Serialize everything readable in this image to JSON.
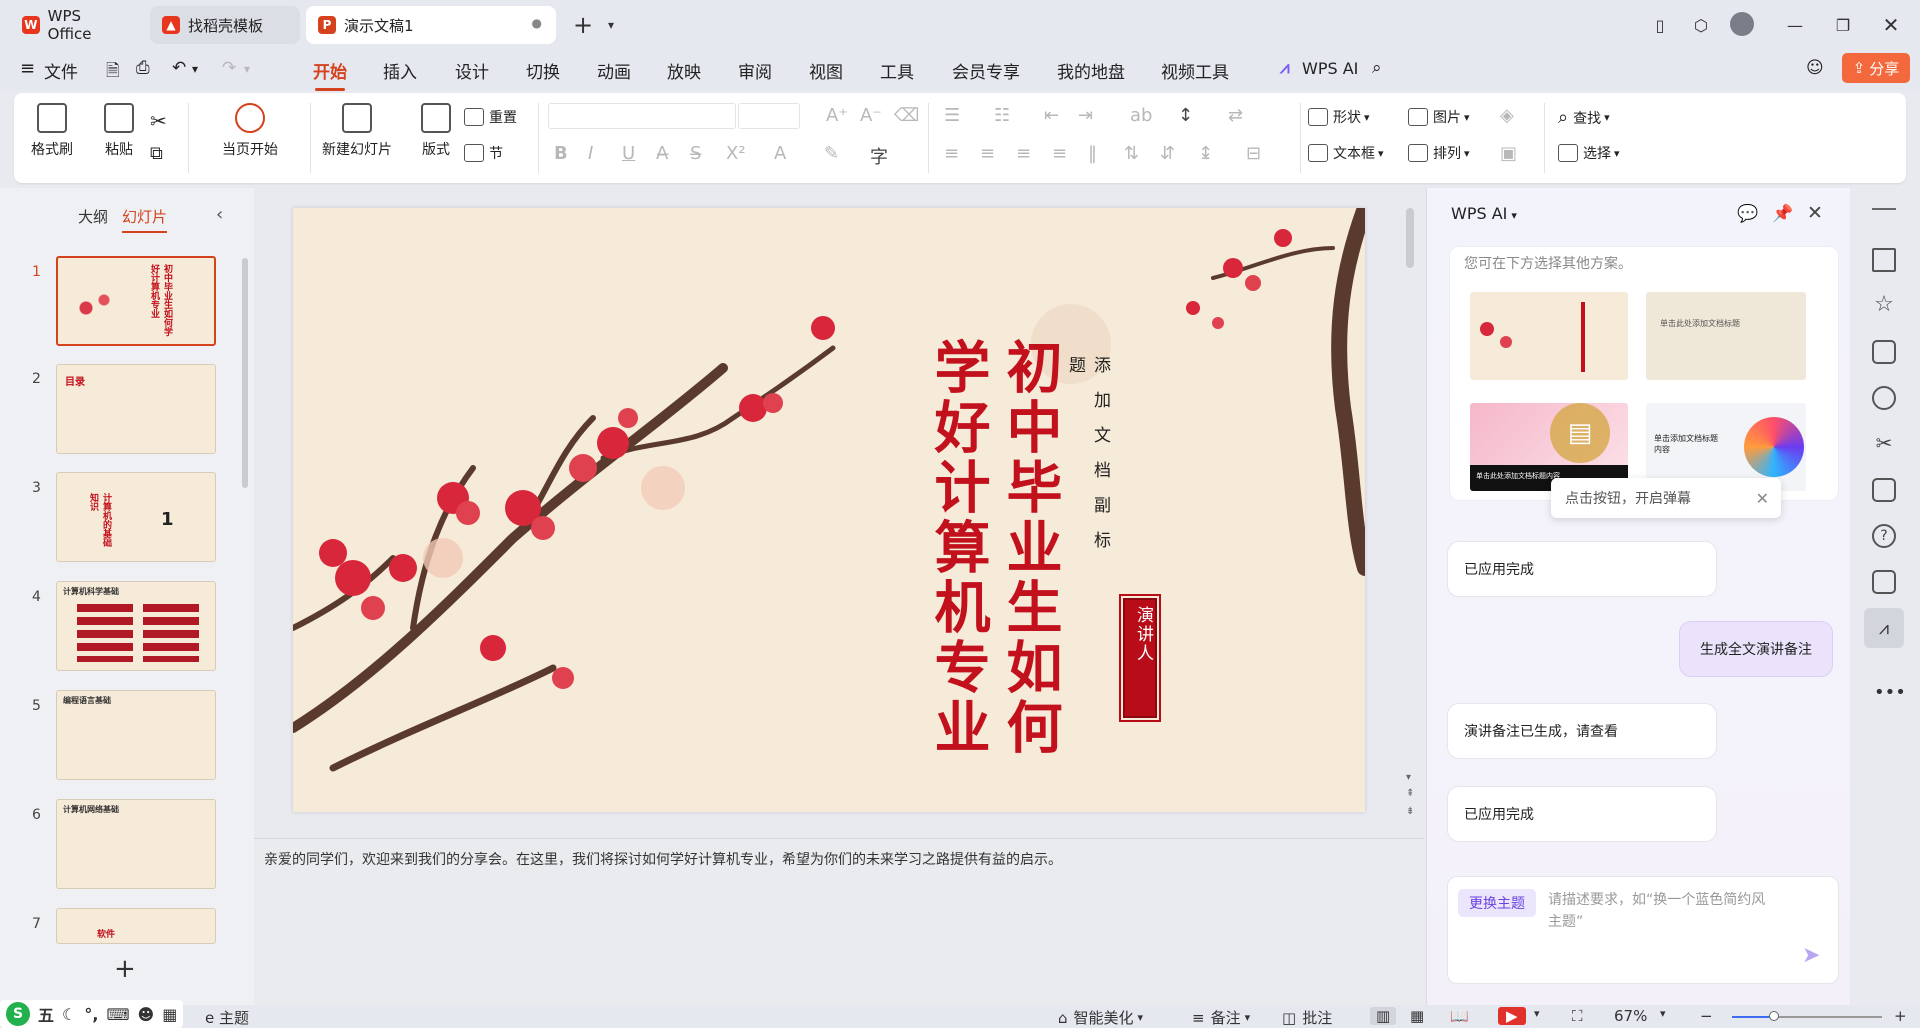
{
  "tabs": [
    {
      "label": "WPS Office",
      "icon": "wps-logo-icon"
    },
    {
      "label": "找稻壳模板",
      "icon": "docer-icon"
    },
    {
      "label": "演示文稿1",
      "icon": "presentation-icon"
    }
  ],
  "window": {
    "new_tab": "+"
  },
  "menu": {
    "file": "文件",
    "items": [
      "开始",
      "插入",
      "设计",
      "切换",
      "动画",
      "放映",
      "审阅",
      "视图",
      "工具",
      "会员专享",
      "我的地盘",
      "视频工具"
    ],
    "active": "开始",
    "wps_ai": "WPS AI",
    "share": "分享"
  },
  "ribbon": {
    "format_painter": "格式刷",
    "paste": "粘贴",
    "play_from_current": "当页开始",
    "new_slide": "新建幻灯片",
    "layout": "版式",
    "reset": "重置",
    "section": "节",
    "shape": "形状",
    "picture": "图片",
    "find": "查找",
    "textbox": "文本框",
    "arrange": "排列",
    "select": "选择"
  },
  "left_panel": {
    "tab_outline": "大纲",
    "tab_slides": "幻灯片",
    "slide_numbers": [
      "1",
      "2",
      "3",
      "4",
      "5",
      "6",
      "7"
    ],
    "thumb_texts": {
      "s1": "初中毕业生如何学好计算机专业",
      "s2": "目录",
      "s3_title": "计算机的基础知识",
      "s3_num": "1",
      "s4": "计算机科学基础",
      "s5": "编程语言基础",
      "s6": "计算机网络基础",
      "s7": "软件"
    },
    "add": "+"
  },
  "slide": {
    "title_col1": "初中毕业生如何",
    "title_col2": "学好计算机专业",
    "subtitle": "添加文档副标题",
    "speaker": "演讲人"
  },
  "notes": "亲爱的同学们，欢迎来到我们的分享会。在这里，我们将探讨如何学好计算机专业，希望为你们的未来学习之路提供有益的启示。",
  "ai_panel": {
    "title": "WPS AI",
    "hint": "您可在下方选择其他方案。",
    "popup": "点击按钮，开启弹幕",
    "thumb_texts": [
      "单击此处添加文档标题内容",
      "单击此处添加文档标题",
      "单击添加文档标题内容"
    ],
    "messages": [
      {
        "from": "ai",
        "text": "已应用完成"
      },
      {
        "from": "user",
        "text": "生成全文演讲备注"
      },
      {
        "from": "ai",
        "text": "演讲备注已生成，请查看"
      },
      {
        "from": "ai",
        "text": "已应用完成"
      }
    ],
    "theme_button": "更换主题",
    "input_placeholder": "请描述要求，如“换一个蓝色简约风主题”"
  },
  "status": {
    "ime": "五",
    "theme_label": "e 主题",
    "beautify": "智能美化",
    "notes": "备注",
    "comments": "批注",
    "zoom": "67%",
    "zoom_fraction": 0.28
  },
  "colors": {
    "accent": "#d4421e",
    "slide_red": "#c2101c",
    "ai_purple": "#7b5cf0"
  }
}
